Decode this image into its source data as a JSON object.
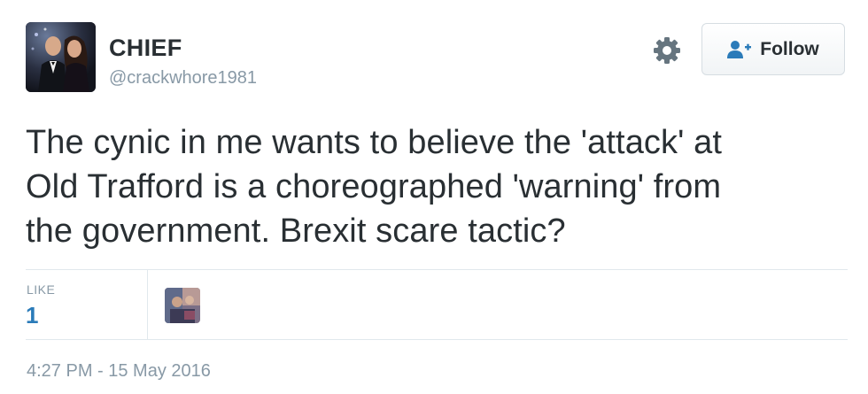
{
  "user": {
    "display_name": "CHIEF",
    "screen_name": "@crackwhore1981"
  },
  "header": {
    "follow_label": "Follow",
    "settings_icon": "gear-icon",
    "follow_icon": "person-plus-icon"
  },
  "tweet": {
    "line1": "The cynic in me wants to believe the 'attack' at",
    "line2": "Old Trafford is a choreographed 'warning' from",
    "line3": "the government. Brexit scare tactic?"
  },
  "stats": {
    "like_label": "LIKE",
    "like_count": "1"
  },
  "meta": {
    "timestamp": "4:27 PM - 15 May 2016"
  },
  "colors": {
    "text": "#292f33",
    "muted": "#8899a6",
    "accent_blue": "#2b7bb9",
    "divider": "#e1e8ed"
  }
}
